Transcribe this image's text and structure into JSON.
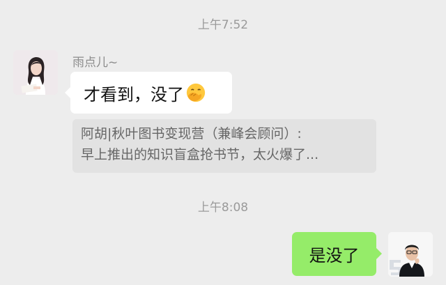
{
  "timestamps": [
    "上午7:52",
    "上午8:08"
  ],
  "messages": {
    "incoming": {
      "sender_name": "雨点儿~",
      "text": "才看到，没了",
      "emoji": "hand-over-face-emoji"
    },
    "quote": {
      "line1": "阿胡|秋叶图书变现营（兼峰会顾问）:",
      "line2": "早上推出的知识盲盒抢书节，太火爆了..."
    },
    "outgoing": {
      "text": "是没了"
    }
  },
  "colors": {
    "background": "#ededed",
    "incoming_bubble": "#ffffff",
    "outgoing_bubble": "#95ec69",
    "quote_box": "#e2e2e2",
    "timestamp_text": "#9a9a9a"
  },
  "icons": {
    "left_avatar": "woman-avatar",
    "right_avatar": "man-avatar"
  }
}
